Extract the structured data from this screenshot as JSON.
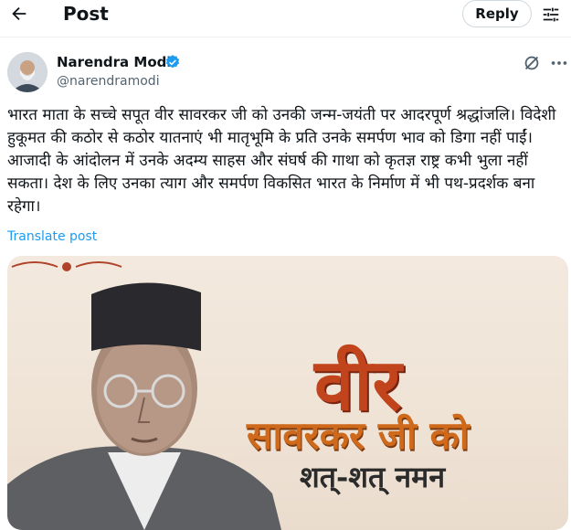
{
  "header": {
    "title": "Post",
    "reply_label": "Reply"
  },
  "author": {
    "name": "Narendra Modi",
    "handle": "@narendramodi",
    "verified": true
  },
  "post": {
    "text": "भारत माता के सच्चे सपूत वीर सावरकर जी को उनकी जन्म-जयंती पर आदरपूर्ण श्रद्धांजलि। विदेशी हुकूमत की कठोर से कठोर यातनाएं भी मातृभूमि के प्रति उनके समर्पण भाव को डिगा नहीं पाईं। आजादी के आंदोलन में उनके अदम्य साहस और संघर्ष की गाथा को कृतज्ञ राष्ट्र कभी भुला नहीं सकता। देश के लिए उनका त्याग और समर्पण विकसित भारत के निर्माण में भी पथ-प्रदर्शक बना रहेगा।",
    "translate_label": "Translate post"
  },
  "media": {
    "line1": "वीर",
    "line2": "सावरकर जी को",
    "line3": "शत्-शत् नमन"
  },
  "icons": {
    "back": "arrow-left-icon",
    "settings": "sliders-icon",
    "verified": "verified-badge-icon",
    "grok": "grok-icon",
    "more": "more-icon"
  },
  "colors": {
    "link": "#1d9bf0",
    "verified": "#1d9bf0",
    "accent_text": "#c2441c"
  }
}
